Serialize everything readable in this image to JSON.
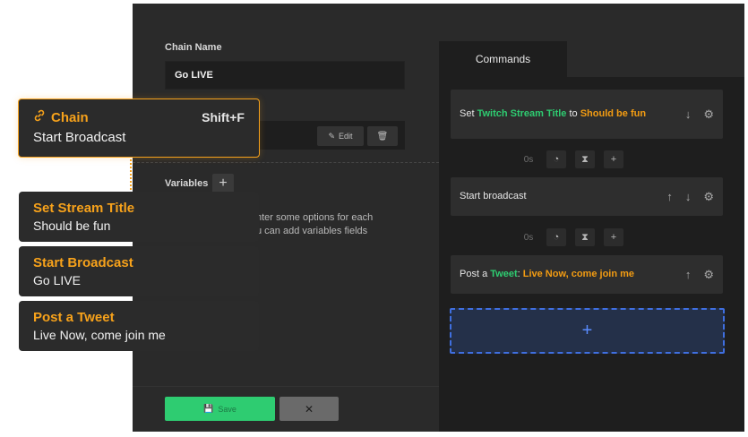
{
  "window": {
    "minimize": "—",
    "close": "✕"
  },
  "chain": {
    "name_label": "Chain Name",
    "name_value": "Go LIVE",
    "edit_label": "Edit",
    "variables_label": "Variables",
    "variables_info": "nter some options for each\nu can add variables fields",
    "save_label": "Save",
    "cancel_label": "✕"
  },
  "tabs": {
    "commands": "Commands"
  },
  "commands": [
    {
      "prefix": "Set ",
      "green": "Twitch Stream Title",
      "mid": " to ",
      "orange": "Should be fun"
    },
    {
      "text": "Start broadcast"
    },
    {
      "prefix": "Post a ",
      "green": "Tweet",
      "mid": ": ",
      "orange": "Live Now, come join me"
    }
  ],
  "timers": [
    {
      "value": "0s"
    },
    {
      "value": "0s"
    }
  ],
  "callouts": {
    "chain": {
      "title": "Chain",
      "shortcut": "Shift+F",
      "subtitle": "Start Broadcast"
    },
    "steps": [
      {
        "title": "Set Stream Title",
        "subtitle": "Should be fun"
      },
      {
        "title": "Start Broadcast",
        "subtitle": "Go LIVE"
      },
      {
        "title": "Post a Tweet",
        "subtitle": "Live Now, come join me"
      }
    ]
  },
  "colors": {
    "accent": "#f7a21b",
    "green": "#2ecc71",
    "orange": "#f39c12",
    "blue": "#3f6fe0"
  }
}
